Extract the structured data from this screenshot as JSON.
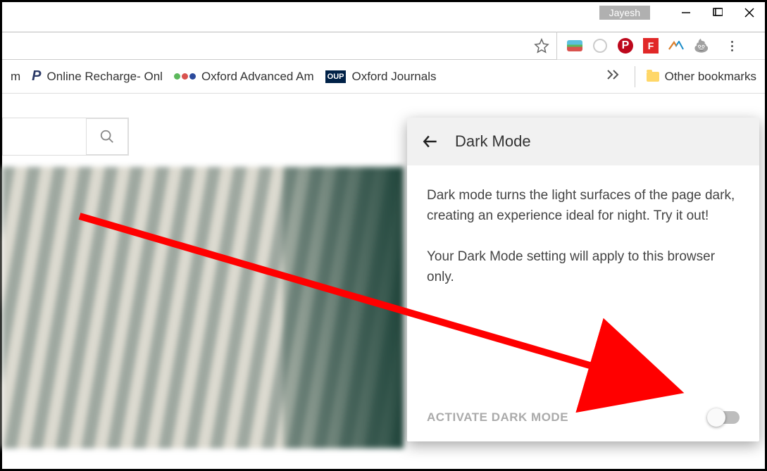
{
  "titlebar": {
    "user_name": "Jayesh"
  },
  "bookmarks": {
    "item_close_text": "m",
    "item1": "Online Recharge- Onl",
    "item2": "Oxford Advanced Am",
    "item3_icon_text": "OUP",
    "item3": "Oxford Journals",
    "other": "Other bookmarks"
  },
  "panel": {
    "title": "Dark Mode",
    "para1": "Dark mode turns the light surfaces of the page dark, creating an experience ideal for night. Try it out!",
    "para2": "Your Dark Mode setting will apply to this browser only.",
    "activate_label": "ACTIVATE DARK MODE"
  },
  "ext": {
    "pinterest_letter": "P",
    "flipboard_letter": "F"
  }
}
